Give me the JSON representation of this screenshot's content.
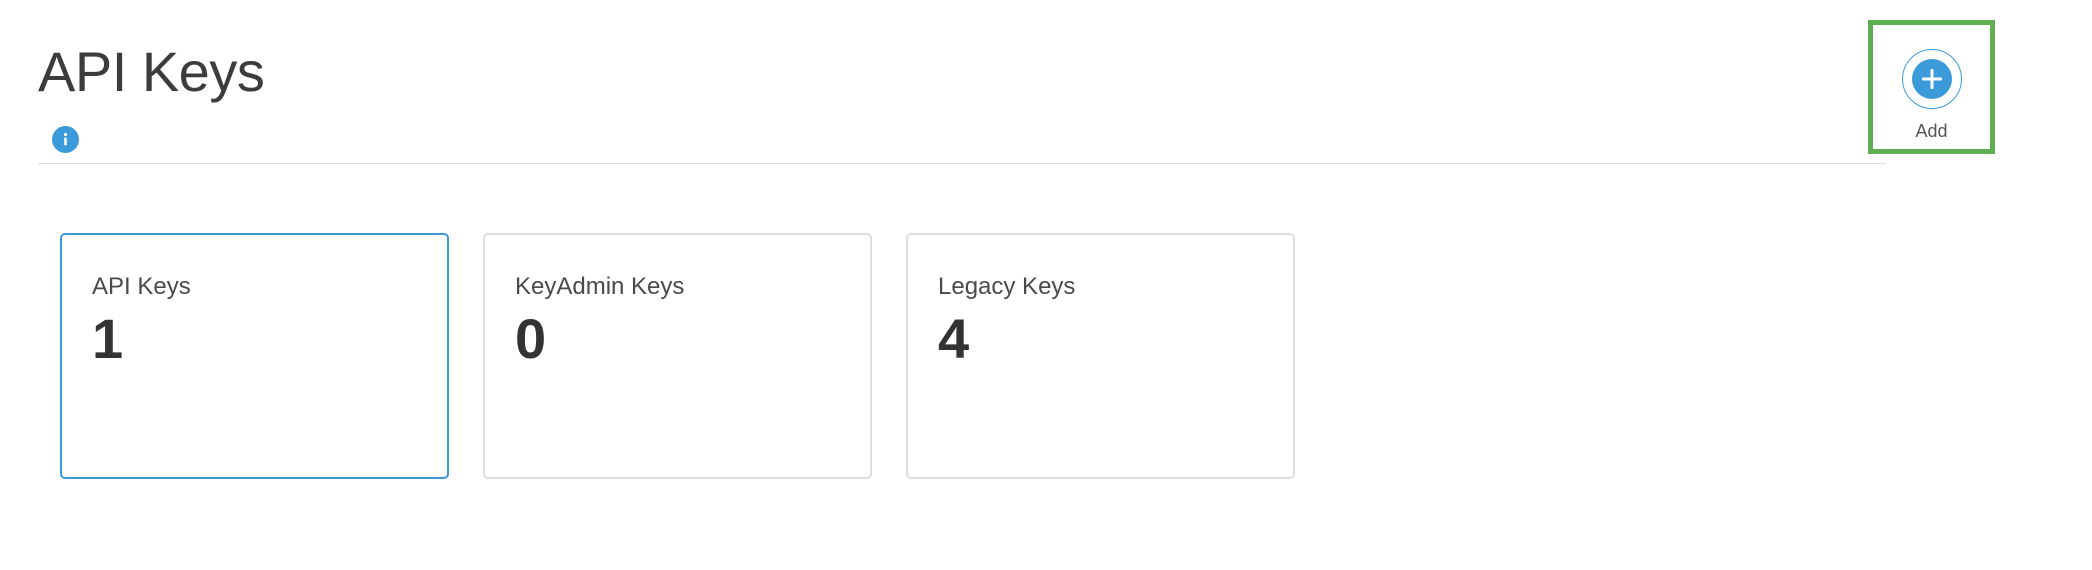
{
  "header": {
    "title": "API Keys",
    "info_icon": "info-icon"
  },
  "add_button": {
    "label": "Add",
    "icon": "plus-circle-icon",
    "highlight_color": "#5fae4f"
  },
  "accent_color": "#3b9ad9",
  "cards": [
    {
      "label": "API Keys",
      "value": "1",
      "selected": true
    },
    {
      "label": "KeyAdmin Keys",
      "value": "0",
      "selected": false
    },
    {
      "label": "Legacy Keys",
      "value": "4",
      "selected": false
    }
  ]
}
